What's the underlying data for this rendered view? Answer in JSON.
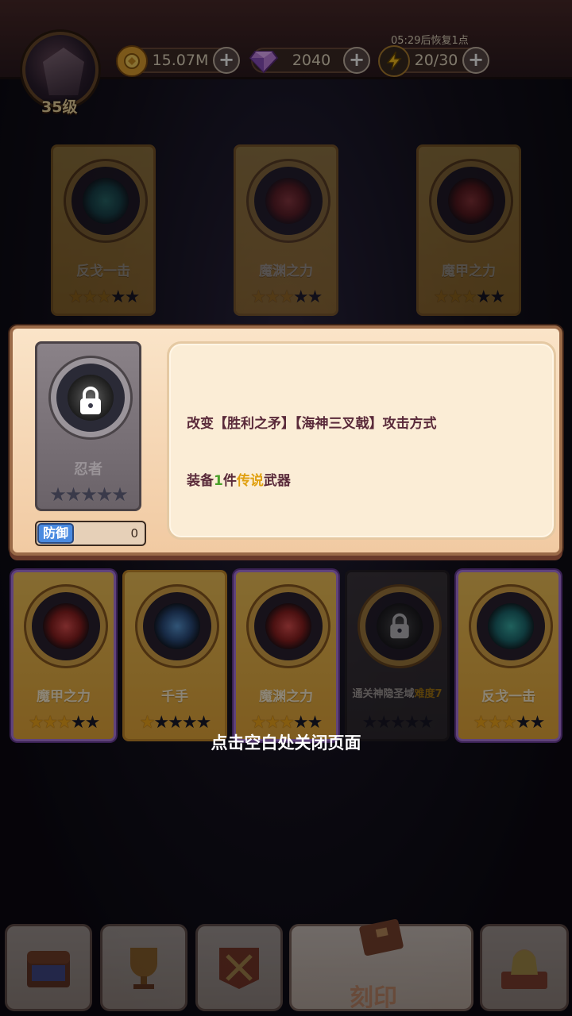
{
  "player": {
    "level_label": "35级"
  },
  "resources": [
    {
      "name": "gold",
      "icon": "gold-coin-icon",
      "value": "15.07M"
    },
    {
      "name": "gems",
      "icon": "gem-icon",
      "value": "2040"
    },
    {
      "name": "energy",
      "icon": "lightning-icon",
      "value": "20/30"
    }
  ],
  "energy_recover_text": "05:29后恢复1点",
  "top_cards": [
    {
      "name": "反戈一击",
      "stars": 3,
      "max_stars": 5,
      "emblem": "teal"
    },
    {
      "name": "魔渊之力",
      "stars": 3,
      "max_stars": 5,
      "emblem": "red"
    },
    {
      "name": "魔甲之力",
      "stars": 3,
      "max_stars": 5,
      "emblem": "red"
    }
  ],
  "detail": {
    "card_name": "忍者",
    "stars": 0,
    "max_stars": 5,
    "locked": true,
    "stat_label": "防御",
    "stat_value": "0",
    "effect_text": "改变【胜利之矛】【海神三叉戟】攻击方式",
    "requirement_prefix": "装备",
    "requirement_count": "1",
    "requirement_unit": "件",
    "requirement_rarity": "传说",
    "requirement_suffix": "武器"
  },
  "bottom_cards": [
    {
      "name": "魔甲之力",
      "stars": 3,
      "max_stars": 5,
      "emblem": "red",
      "locked": false
    },
    {
      "name": "千手",
      "stars": 1,
      "max_stars": 5,
      "emblem": "blue",
      "locked": false
    },
    {
      "name": "魔渊之力",
      "stars": 3,
      "max_stars": 5,
      "emblem": "red",
      "locked": false
    },
    {
      "name": "通关神隐圣域难度7",
      "name_main": "通关神隐圣域",
      "name_hl": "难度7",
      "stars": 0,
      "max_stars": 5,
      "emblem": "grey",
      "locked": true
    },
    {
      "name": "反戈一击",
      "stars": 3,
      "max_stars": 5,
      "emblem": "teal",
      "locked": false
    }
  ],
  "close_hint": "点击空白处关闭页面",
  "nav": {
    "items": [
      {
        "icon": "treasure-chest-icon"
      },
      {
        "icon": "trophy-icon"
      },
      {
        "icon": "battle-banner-icon"
      },
      {
        "icon": "engrave-book-icon",
        "label": "刻印",
        "active": true
      },
      {
        "icon": "character-book-icon"
      }
    ]
  },
  "colors": {
    "card_gold": "#f3c45a",
    "star_on": "#f3a81c",
    "star_off": "#1a1a2a",
    "defense_tag": "#4a8ae0",
    "highlight_green": "#4aa02a",
    "highlight_gold": "#e0a010"
  }
}
